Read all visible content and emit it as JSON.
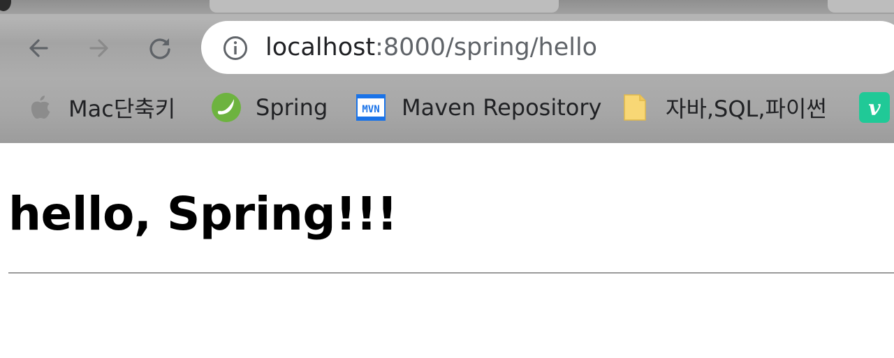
{
  "browser": {
    "address_bar": {
      "host": "localhost",
      "path": ":8000/spring/hello"
    },
    "nav_icons": [
      "back-arrow-icon",
      "forward-arrow-icon",
      "reload-icon"
    ],
    "bookmarks": [
      {
        "label": "Mac단축키",
        "icon": "apple-icon"
      },
      {
        "label": "Spring",
        "icon": "spring-leaf-icon"
      },
      {
        "label": "Maven Repository",
        "icon": "mvn-icon"
      },
      {
        "label": "자바,SQL,파이썬",
        "icon": "folder-icon"
      },
      {
        "label": "",
        "icon": "v-app-icon"
      }
    ]
  },
  "page": {
    "heading": "hello, Spring!!!"
  },
  "colors": {
    "spring_green": "#6db33f",
    "maven_blue": "#1a73e8",
    "folder_yellow": "#f8d775",
    "v_green": "#20c997"
  }
}
